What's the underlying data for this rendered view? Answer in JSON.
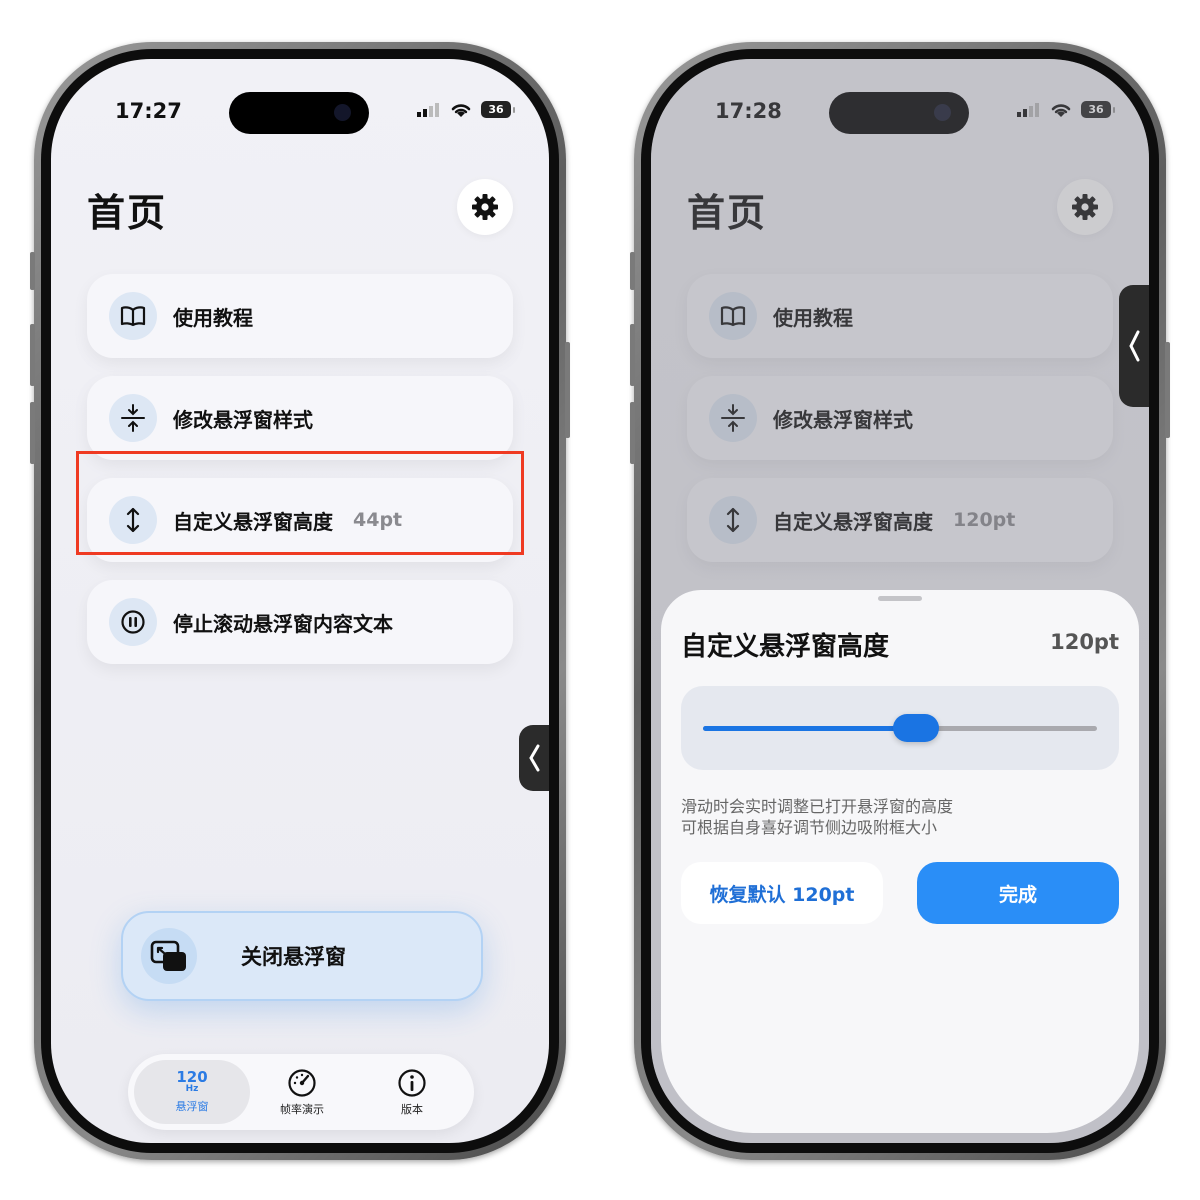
{
  "left_screen": {
    "status": {
      "time": "17:27",
      "battery": "36"
    },
    "page_title": "首页",
    "menu": [
      {
        "label": "使用教程",
        "value": ""
      },
      {
        "label": "修改悬浮窗样式",
        "value": ""
      },
      {
        "label": "自定义悬浮窗高度",
        "value": "44pt"
      },
      {
        "label": "停止滚动悬浮窗内容文本",
        "value": ""
      }
    ],
    "close_button": "关闭悬浮窗",
    "tabs": [
      {
        "num": "120",
        "unit": "Hz",
        "label": "悬浮窗",
        "active": true
      },
      {
        "label": "帧率演示",
        "icon": "gauge-icon"
      },
      {
        "label": "版本",
        "icon": "info-icon"
      }
    ]
  },
  "right_screen": {
    "status": {
      "time": "17:28",
      "battery": "36"
    },
    "page_title": "首页",
    "menu": [
      {
        "label": "使用教程",
        "value": ""
      },
      {
        "label": "修改悬浮窗样式",
        "value": ""
      },
      {
        "label": "自定义悬浮窗高度",
        "value": "120pt"
      }
    ],
    "sheet": {
      "title": "自定义悬浮窗高度",
      "value": "120pt",
      "slider_fraction": 0.54,
      "desc_line1": "滑动时会实时调整已打开悬浮窗的高度",
      "desc_line2": "可根据自身喜好调节侧边吸附框大小",
      "reset_label": "恢复默认 120pt",
      "done_label": "完成"
    }
  },
  "colors": {
    "accent": "#2a8ef7",
    "highlight": "#ef3a22",
    "icon_bg": "#dde7f4"
  }
}
